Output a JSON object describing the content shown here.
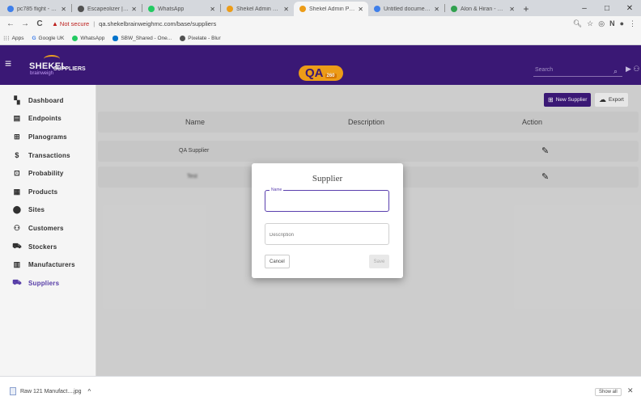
{
  "browser": {
    "tabs": [
      {
        "label": "pc785 flight - Google",
        "color": "#4285f4",
        "active": false
      },
      {
        "label": "Escapeolizer | Pixelate",
        "color": "#555555",
        "active": false
      },
      {
        "label": "WhatsApp",
        "color": "#25d366",
        "active": false
      },
      {
        "label": "Shekel Admin Panel",
        "color": "#f6a31a",
        "active": false
      },
      {
        "label": "Shekel Admin Panel",
        "color": "#f6a31a",
        "active": true
      },
      {
        "label": "Untitled document - G",
        "color": "#4285f4",
        "active": false
      },
      {
        "label": "Alon & Hiran - Google",
        "color": "#34a853",
        "active": false
      }
    ],
    "new_tab": "+",
    "window_controls": [
      "–",
      "□",
      "✕"
    ],
    "nav": {
      "back": "←",
      "forward": "→",
      "reload": "C"
    },
    "security_label": "Not secure",
    "url": "qa.shekelbrainweighmc.com/base/suppliers",
    "bookmarks": [
      {
        "label": "Apps",
        "color": "#777777"
      },
      {
        "label": "Google UK",
        "color": "#4285f4"
      },
      {
        "label": "WhatsApp",
        "color": "#25d366"
      },
      {
        "label": "SBW_Shared - One...",
        "color": "#0078d4"
      },
      {
        "label": "Pixelate - Blur",
        "color": "#555555"
      }
    ]
  },
  "app": {
    "logo_text": "SHEKEL",
    "logo_sub": "brainweigh",
    "section": "SUPPLIERS",
    "env_badge": "QA",
    "env_small": "260",
    "search_placeholder": "Search",
    "accent_color": "#3d1a7a",
    "badge_color": "#f6a31a"
  },
  "sidebar": {
    "items": [
      {
        "label": "Dashboard",
        "icon": "▚",
        "name": "dashboard"
      },
      {
        "label": "Endpoints",
        "icon": "▤",
        "name": "endpoints"
      },
      {
        "label": "Planograms",
        "icon": "⊞",
        "name": "planograms"
      },
      {
        "label": "Transactions",
        "icon": "$",
        "name": "transactions"
      },
      {
        "label": "Probability",
        "icon": "⊡",
        "name": "probability"
      },
      {
        "label": "Products",
        "icon": "▦",
        "name": "products"
      },
      {
        "label": "Sites",
        "icon": "⬤",
        "name": "sites"
      },
      {
        "label": "Customers",
        "icon": "⚇",
        "name": "customers"
      },
      {
        "label": "Stockers",
        "icon": "⛟",
        "name": "stockers"
      },
      {
        "label": "Manufacturers",
        "icon": "▥",
        "name": "manufacturers"
      },
      {
        "label": "Suppliers",
        "icon": "⛟",
        "name": "suppliers",
        "active": true
      }
    ]
  },
  "toolbar": {
    "new_supplier_label": "New Supplier",
    "export_label": "Export"
  },
  "table": {
    "headers": {
      "name": "Name",
      "description": "Description",
      "action": "Action"
    },
    "rows": [
      {
        "name": "QA Supplier",
        "description": ""
      },
      {
        "name": "Test",
        "description": ""
      }
    ]
  },
  "dialog": {
    "title": "Supplier",
    "name_label": "Name",
    "name_value": "",
    "description_placeholder": "Description",
    "cancel_label": "Cancel",
    "save_label": "Save"
  },
  "downloads": {
    "file": "Raw 121 Manufact....jpg",
    "show_all": "Show all"
  }
}
